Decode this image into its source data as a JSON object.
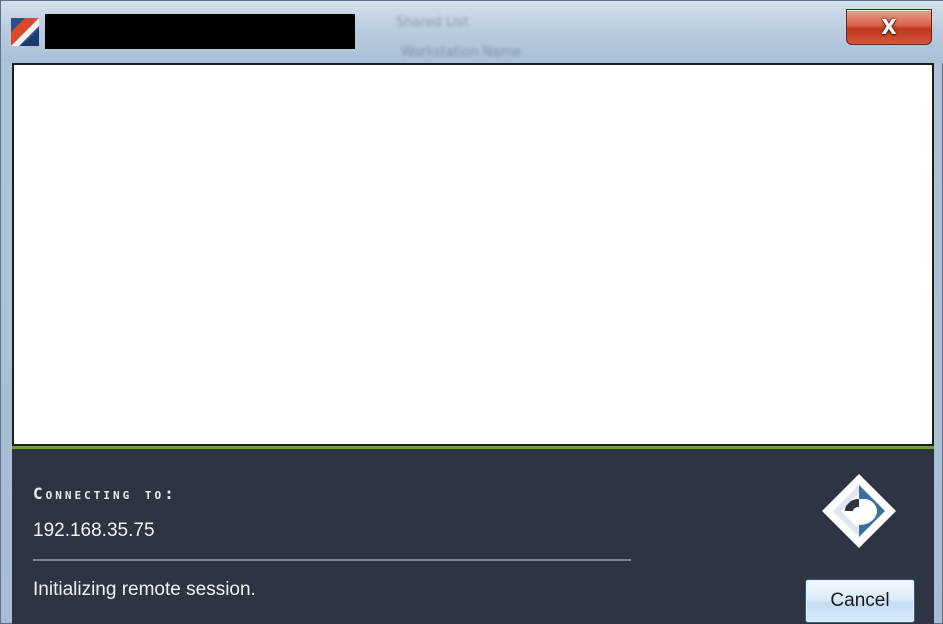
{
  "window": {
    "title": "",
    "close_glyph": "X",
    "app_icon": "app-icon",
    "background_text": [
      "Shared List",
      "Workstation Name"
    ]
  },
  "panel": {
    "connecting_label": "Connecting to:",
    "host": "192.168.35.75",
    "status": "Initializing remote session.",
    "cancel_label": "Cancel",
    "logo": "remote-session-logo"
  },
  "colors": {
    "panel_bg": "#2f3443",
    "accent_green": "#6fa03a",
    "close_red": "#c9472e",
    "button_blue": "#c3ddf4"
  }
}
